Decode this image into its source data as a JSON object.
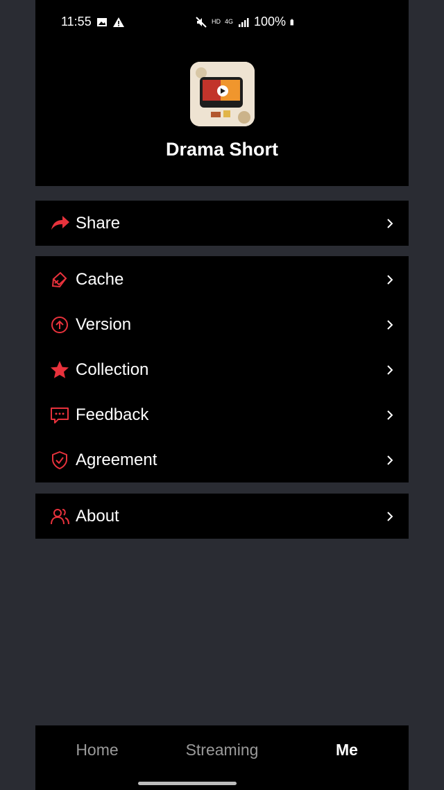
{
  "status_bar": {
    "time": "11:55",
    "network": "4G",
    "battery": "100%"
  },
  "app": {
    "name": "Drama Short"
  },
  "menu": {
    "share": {
      "label": "Share"
    },
    "items": [
      {
        "label": "Cache",
        "icon": "cache-icon"
      },
      {
        "label": "Version",
        "icon": "version-up-icon"
      },
      {
        "label": "Collection",
        "icon": "star-icon"
      },
      {
        "label": "Feedback",
        "icon": "feedback-icon"
      },
      {
        "label": "Agreement",
        "icon": "shield-icon"
      }
    ],
    "about": {
      "label": "About"
    }
  },
  "bottom_nav": {
    "tabs": [
      {
        "label": "Home",
        "active": false
      },
      {
        "label": "Streaming",
        "active": false
      },
      {
        "label": "Me",
        "active": true
      }
    ]
  },
  "colors": {
    "accent": "#e8323c",
    "background": "#2a2c33",
    "card": "#000000",
    "text": "#ffffff",
    "inactive_tab": "#9a9a9a"
  }
}
